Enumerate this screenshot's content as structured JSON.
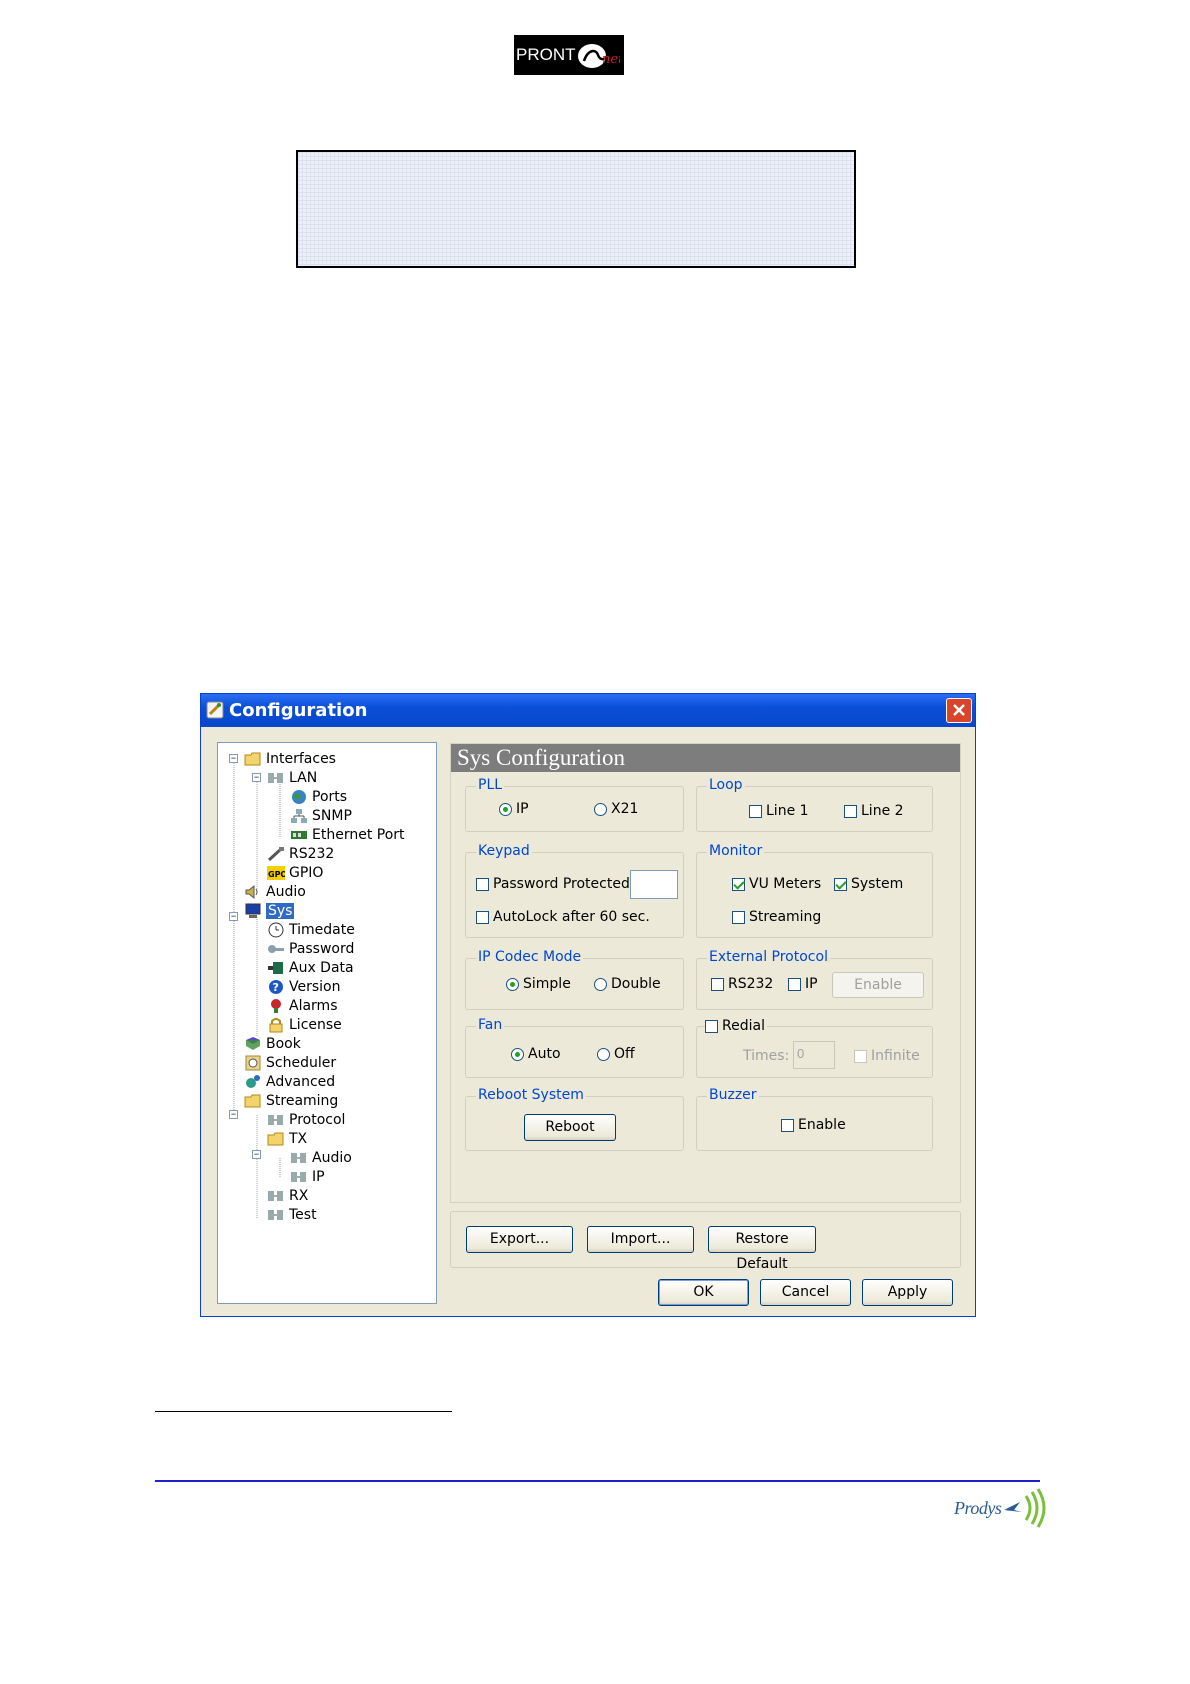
{
  "header": {
    "logo_text": "PRONT",
    "logo_script": "net"
  },
  "dialog": {
    "title": "Configuration",
    "tree": [
      {
        "label": "Interfaces",
        "icon": "folder-icon"
      },
      {
        "label": "LAN",
        "icon": "network-icon"
      },
      {
        "label": "Ports",
        "icon": "globe-icon"
      },
      {
        "label": "SNMP",
        "icon": "snmp-icon"
      },
      {
        "label": "Ethernet Port",
        "icon": "ethernet-card-icon"
      },
      {
        "label": "RS232",
        "icon": "serial-cable-icon"
      },
      {
        "label": "GPIO",
        "icon": "gpio-icon"
      },
      {
        "label": "Audio",
        "icon": "speaker-icon"
      },
      {
        "label": "Sys",
        "icon": "monitor-icon"
      },
      {
        "label": "Timedate",
        "icon": "clock-icon"
      },
      {
        "label": "Password",
        "icon": "key-icon"
      },
      {
        "label": "Aux Data",
        "icon": "aux-data-icon"
      },
      {
        "label": "Version",
        "icon": "help-icon"
      },
      {
        "label": "Alarms",
        "icon": "alarm-icon"
      },
      {
        "label": "License",
        "icon": "lock-icon"
      },
      {
        "label": "Book",
        "icon": "book-icon"
      },
      {
        "label": "Scheduler",
        "icon": "scheduler-icon"
      },
      {
        "label": "Advanced",
        "icon": "advanced-icon"
      },
      {
        "label": "Streaming",
        "icon": "folder-icon"
      },
      {
        "label": "Protocol",
        "icon": "network-icon"
      },
      {
        "label": "TX",
        "icon": "folder-icon"
      },
      {
        "label": "Audio",
        "icon": "network-icon"
      },
      {
        "label": "IP",
        "icon": "network-icon"
      },
      {
        "label": "RX",
        "icon": "network-icon"
      },
      {
        "label": "Test",
        "icon": "network-icon"
      }
    ],
    "panel_title": "Sys Configuration",
    "pll": {
      "label": "PLL",
      "opt1": "IP",
      "opt2": "X21",
      "selected": "IP"
    },
    "loop": {
      "label": "Loop",
      "opt1": "Line 1",
      "opt2": "Line 2"
    },
    "keypad": {
      "label": "Keypad",
      "password_protected": "Password Protected",
      "autolock": "AutoLock after 60 sec."
    },
    "monitor": {
      "label": "Monitor",
      "vu_meters": "VU Meters",
      "system": "System",
      "streaming": "Streaming"
    },
    "ip_codec_mode": {
      "label": "IP Codec Mode",
      "opt1": "Simple",
      "opt2": "Double",
      "selected": "Simple"
    },
    "external_protocol": {
      "label": "External Protocol",
      "rs232": "RS232",
      "ip": "IP",
      "enable_button": "Enable"
    },
    "fan": {
      "label": "Fan",
      "opt1": "Auto",
      "opt2": "Off",
      "selected": "Auto"
    },
    "redial": {
      "label": "Redial",
      "times_label": "Times:",
      "times_value": "0",
      "infinite": "Infinite"
    },
    "reboot": {
      "label": "Reboot System",
      "button": "Reboot"
    },
    "buzzer": {
      "label": "Buzzer",
      "enable": "Enable"
    },
    "buttons": {
      "export": "Export...",
      "import": "Import...",
      "restore": "Restore Default",
      "ok": "OK",
      "cancel": "Cancel",
      "apply": "Apply"
    }
  },
  "footer": {
    "brand": "Prodys"
  },
  "colors": {
    "title_bar": "#0a4fd8",
    "group_label": "#0046d5",
    "footer_rule": "#1f1fd0"
  }
}
